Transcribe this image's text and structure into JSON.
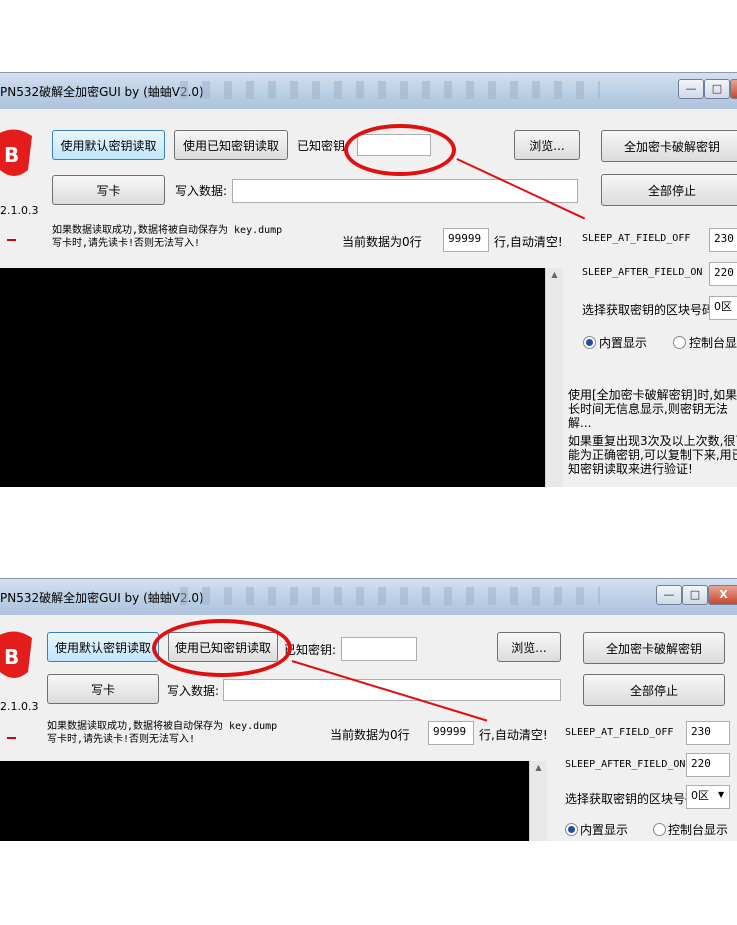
{
  "window_title": "PN532破解全加密GUI by (蚰蚰V2.0)",
  "window_buttons": {
    "minimize": "—",
    "maximize": "□",
    "close": "X"
  },
  "version": "2.1.0.3",
  "buttons": {
    "read_default": "使用默认密钥读取",
    "read_known": "使用已知密钥读取",
    "browse": "浏览...",
    "crack": "全加密卡破解密钥",
    "write_card": "写卡",
    "stop_all": "全部停止"
  },
  "labels": {
    "known_key": "已知密钥:",
    "write_data": "写入数据:",
    "current_rows": "当前数据为0行",
    "rows_auto_clear": "行,自动清空!",
    "sleep_at_field_off": "SLEEP_AT_FIELD_OFF",
    "sleep_after_field_on": "SLEEP_AFTER_FIELD_ON",
    "select_block": "选择获取密钥的区块号码:",
    "builtin_display": "内置显示",
    "console_display": "控制台显示"
  },
  "info": {
    "line1": "如果数据读取成功,数据将被自动保存为 key.dump",
    "line2": "写卡时,请先读卡!否则无法写入!"
  },
  "values": {
    "known_key": "",
    "write_data": "",
    "max_rows": "99999",
    "sleep_at_field_off": "230",
    "sleep_after_field_on": "220",
    "block": "0区",
    "display_mode": "内置显示"
  },
  "notes": {
    "p1": "使用[全加密卡破解密钥]时,如果长时间无信息显示,则密钥无法解...",
    "p2": "如果重复出现3次及以上次数,很可能为正确密钥,可以复制下来,用已知密钥读取来进行验证!"
  },
  "annotation": {
    "color": "#e01010"
  }
}
